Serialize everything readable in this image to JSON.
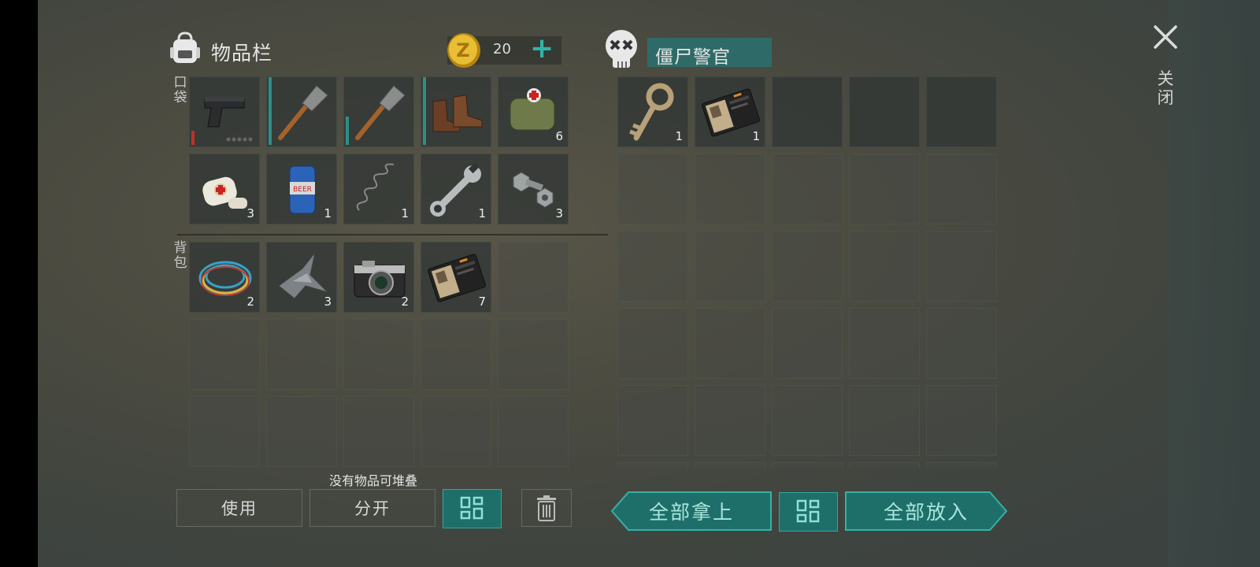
{
  "inventory": {
    "title": "物品栏",
    "coins": "20",
    "plus": "+",
    "pocket_label": "口袋",
    "backpack_label": "背包",
    "pocket_slots": [
      {
        "icon": "pistol-icon",
        "count": ""
      },
      {
        "icon": "shovel-icon",
        "count": ""
      },
      {
        "icon": "shovel-icon",
        "count": ""
      },
      {
        "icon": "boots-icon",
        "count": ""
      },
      {
        "icon": "medkit-bag-icon",
        "count": "6"
      },
      {
        "icon": "bandage-icon",
        "count": "3"
      },
      {
        "icon": "beer-can-icon",
        "count": "1"
      },
      {
        "icon": "spring-icon",
        "count": "1"
      },
      {
        "icon": "wrench-icon",
        "count": "1"
      },
      {
        "icon": "bolt-nut-icon",
        "count": "3"
      }
    ],
    "backpack_slots": [
      {
        "icon": "wire-coil-icon",
        "count": "2"
      },
      {
        "icon": "scrap-metal-icon",
        "count": "3"
      },
      {
        "icon": "camera-icon",
        "count": "2"
      },
      {
        "icon": "police-id-wallet-icon",
        "count": "7"
      }
    ],
    "stack_message": "没有物品可堆叠",
    "use_label": "使用",
    "split_label": "分开"
  },
  "loot": {
    "name": "僵尸警官",
    "slots": [
      {
        "icon": "key-icon",
        "count": "1"
      },
      {
        "icon": "police-id-wallet-icon",
        "count": "1"
      }
    ],
    "take_all_label": "全部拿上",
    "put_all_label": "全部放入"
  },
  "close_label": "关闭",
  "colors": {
    "accent": "#2fb5a8",
    "button_teal": "#1e6f6a",
    "coin": "#e0b22a"
  }
}
